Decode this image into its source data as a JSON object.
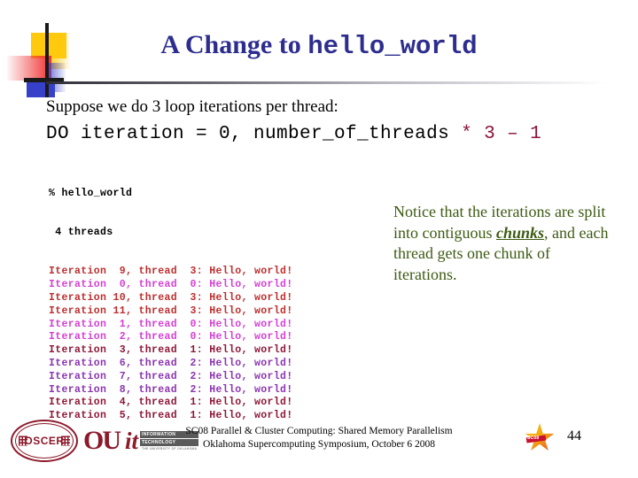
{
  "slide": {
    "title_prefix": "A Change to ",
    "title_code": "hello_world",
    "title_color": "#2D2D8F",
    "intro": "Suppose we do 3 loop iterations per thread:",
    "do_statement_main": "DO iteration = 0, number_of_threads ",
    "do_statement_accent": "* 3 – 1",
    "do_accent_color": "#8E1438"
  },
  "terminal": {
    "prompt_line": "% hello_world",
    "threads_line": " 4 threads",
    "lines": [
      {
        "text": "Iteration  9, thread  3: Hello, world!",
        "thread": "3",
        "iteration": "9",
        "color": "#BE2E2E"
      },
      {
        "text": "Iteration  0, thread  0: Hello, world!",
        "thread": "0",
        "iteration": "0",
        "color": "#D43FD4"
      },
      {
        "text": "Iteration 10, thread  3: Hello, world!",
        "thread": "3",
        "iteration": "10",
        "color": "#BE2E2E"
      },
      {
        "text": "Iteration 11, thread  3: Hello, world!",
        "thread": "3",
        "iteration": "11",
        "color": "#BE2E2E"
      },
      {
        "text": "Iteration  1, thread  0: Hello, world!",
        "thread": "0",
        "iteration": "1",
        "color": "#D43FD4"
      },
      {
        "text": "Iteration  2, thread  0: Hello, world!",
        "thread": "0",
        "iteration": "2",
        "color": "#D43FD4"
      },
      {
        "text": "Iteration  3, thread  1: Hello, world!",
        "thread": "1",
        "iteration": "3",
        "color": "#8E1838"
      },
      {
        "text": "Iteration  6, thread  2: Hello, world!",
        "thread": "2",
        "iteration": "6",
        "color": "#8B34B0"
      },
      {
        "text": "Iteration  7, thread  2: Hello, world!",
        "thread": "2",
        "iteration": "7",
        "color": "#8B34B0"
      },
      {
        "text": "Iteration  8, thread  2: Hello, world!",
        "thread": "2",
        "iteration": "8",
        "color": "#8B34B0"
      },
      {
        "text": "Iteration  4, thread  1: Hello, world!",
        "thread": "1",
        "iteration": "4",
        "color": "#8E1838"
      },
      {
        "text": "Iteration  5, thread  1: Hello, world!",
        "thread": "1",
        "iteration": "5",
        "color": "#8E1838"
      }
    ]
  },
  "note": {
    "part1": "Notice that the iterations are split into contiguous ",
    "emphasis": "chunks",
    "part2": ", and each thread gets one chunk of iterations.",
    "color": "#3C5A12"
  },
  "footer": {
    "line1": "SC08 Parallel & Cluster Computing: Shared Memory Parallelism",
    "line2": "Oklahoma Supercomputing Symposium, October 6 2008",
    "page_number": "44",
    "oscer_label": "OSCER",
    "ou_label": "OU",
    "it_mark": "it",
    "it_line1": "INFORMATION",
    "it_line2": "TECHNOLOGY",
    "it_line3": "THE UNIVERSITY OF OKLAHOMA",
    "sc_label": "SC08"
  }
}
